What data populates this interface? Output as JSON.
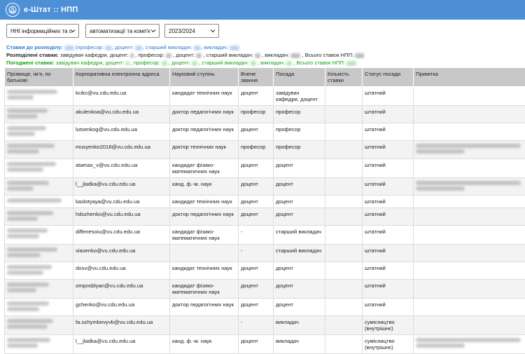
{
  "app": {
    "title": "е-Штат :: НПП"
  },
  "filters": [
    {
      "name": "institute-select",
      "value": "ННІ інформаційних та с"
    },
    {
      "name": "department-select",
      "value": "автоматизації та комп'к"
    },
    {
      "name": "year-select",
      "value": "2023/2024"
    }
  ],
  "summary": {
    "rates_label": "Ставки до розподілу:",
    "rates_parts": [
      "(професор:",
      "доцент:",
      "старший викладач:",
      "викладач:"
    ],
    "distributed_label": "Розподілені ставки:",
    "distributed_parts": [
      "завідувач кафедри, доцент:",
      ", професор:",
      ", доцент:",
      ", старший викладач:",
      ", викладач:",
      ", Всього ставок НПП:"
    ],
    "agreed_label": "Погоджені ставки:",
    "agreed_parts": [
      "завідувач кафедри, доцент:",
      ", професор:",
      ", доцент:",
      ", старший викладач:",
      ", викладач:",
      ", Всього ставок НПП:"
    ]
  },
  "table": {
    "headers": [
      "Прізвище, ім'я, по батькові",
      "Корпоративна електронна адреса",
      "Науковий ступінь",
      "Вчене звання",
      "Посада",
      "Кількість ставки",
      "Статус посади",
      "Примітка"
    ],
    "rows": [
      {
        "email": "kcikc@vu.cdu.edu.ua",
        "degree": "кандидат технічних наук",
        "title": "доцент",
        "position": "завідувач кафедри, доцент",
        "status": "штатний",
        "note": false
      },
      {
        "email": "akulenkoa@vu.cdu.edu.ua",
        "degree": "доктор педагогічних наук",
        "title": "професор",
        "position": "професор",
        "status": "штатний",
        "note": false
      },
      {
        "email": "lutsenkog@vu.cdu.edu.ua",
        "degree": "доктор педагогічних наук",
        "title": "доцент",
        "position": "професор",
        "status": "штатний",
        "note": false
      },
      {
        "email": "musyenko2018@vu.cdu.edu.ua",
        "degree": "доктор технічних наук",
        "title": "професор",
        "position": "професор",
        "status": "штатний",
        "note": true
      },
      {
        "email": "atamas_v@vu.cdu.edu.ua",
        "degree": "кандидат фізико-математичних наук",
        "title": "доцент",
        "position": "доцент",
        "status": "штатний",
        "note": false
      },
      {
        "email": "l__jladka@vu.cdu.edu.ua",
        "degree": "канд. ф.-м. наук",
        "title": "доцент",
        "position": "доцент",
        "status": "штатний",
        "note": true
      },
      {
        "email": "kaslotyaya@vu.cdu.edu.ua",
        "degree": "кандидат технічних наук",
        "title": "доцент",
        "position": "доцент",
        "status": "штатний",
        "note": false
      },
      {
        "email": "hdozhenko@vu.cdu.edu.ua",
        "degree": "доктор педагогічних наук",
        "title": "доцент",
        "position": "доцент",
        "status": "штатний",
        "note": false
      },
      {
        "email": "diffenesoiu@vu.cdu.edu.ua",
        "degree": "кандидат фізико-математичних наук",
        "title": "-",
        "position": "старший викладач",
        "status": "штатний",
        "note": false
      },
      {
        "email": "viasenko@vu.cdu.edu.ua",
        "degree": "",
        "title": "-",
        "position": "старший викладач",
        "status": "штатний",
        "note": false
      },
      {
        "email": "dosv@vu.cdu.edu.ua",
        "degree": "кандидат технічних наук",
        "title": "доцент",
        "position": "доцент",
        "status": "штатний",
        "note": false
      },
      {
        "email": "omposblyan@vu.cdu.edu.ua",
        "degree": "кандидат фізико-математичних наук",
        "title": "доцент",
        "position": "доцент",
        "status": "штатний",
        "note": false
      },
      {
        "email": "gchenko@vu.cdu.edu.ua",
        "degree": "доктор педагогічних наук",
        "title": "доцент",
        "position": "доцент",
        "status": "штатний",
        "note": false
      },
      {
        "email": "fa.ozhymbevyvb@vu.cdu.edu.ua",
        "degree": "",
        "title": "-",
        "position": "викладач",
        "status": "сумісництво (внутрішнє)",
        "note": false
      },
      {
        "email": "l__jladka@vu.cdu.edu.ua",
        "degree": "канд. ф.-м. наук",
        "title": "доцент",
        "position": "викладач",
        "status": "сумісництво (внутрішнє)",
        "note": true
      }
    ]
  }
}
